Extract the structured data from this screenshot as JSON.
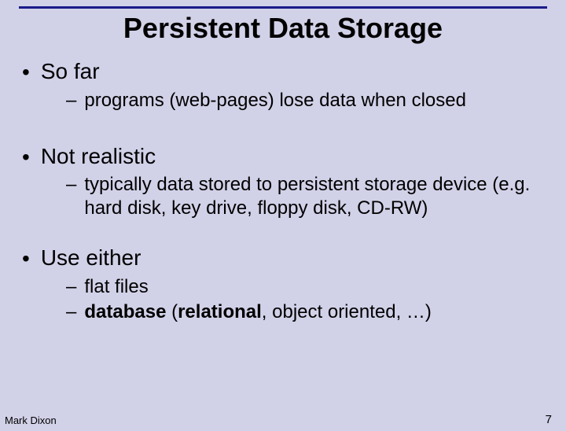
{
  "title": "Persistent Data Storage",
  "bullets": {
    "b1": "So far",
    "s1": "programs (web-pages) lose data when closed",
    "b2": "Not realistic",
    "s2": "typically data stored to persistent storage device (e.g. hard disk, key drive, floppy disk, CD-RW)",
    "b3": "Use either",
    "s3a": "flat files",
    "s3b_bold1": "database",
    "s3b_mid": " (",
    "s3b_bold2": "relational",
    "s3b_rest": ", object oriented, …)"
  },
  "footer": {
    "author": "Mark Dixon",
    "page": "7"
  }
}
